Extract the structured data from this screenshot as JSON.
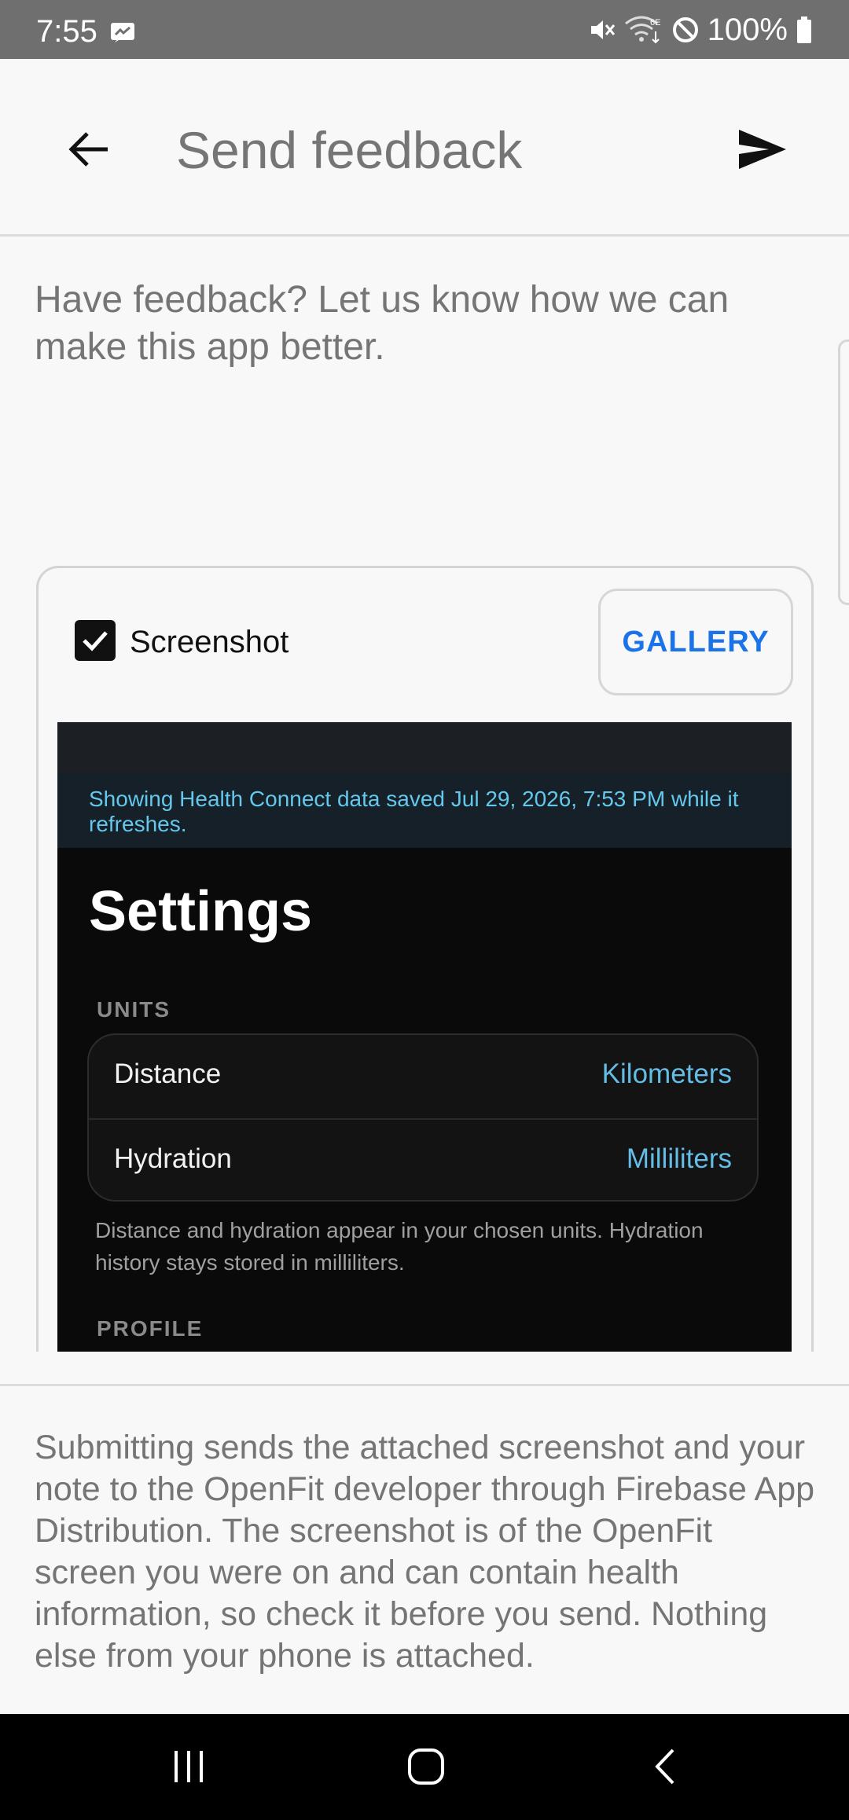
{
  "status_bar": {
    "time": "7:55",
    "battery": "100%",
    "icons": [
      "message-icon",
      "mute-icon",
      "wifi-6e-icon",
      "do-not-disturb-icon",
      "battery-icon"
    ]
  },
  "app_bar": {
    "title": "Send feedback",
    "back_icon": "arrow-left-icon",
    "send_icon": "send-icon"
  },
  "feedback_input": {
    "placeholder": "Have feedback? Let us know how we can make this app better.",
    "value": ""
  },
  "screenshot_card": {
    "checkbox_label": "Screenshot",
    "checked": true,
    "gallery_label": "GALLERY",
    "preview": {
      "banner": "Showing Health Connect data saved Jul 29, 2026, 7:53 PM while it refreshes.",
      "title": "Settings",
      "units_label": "UNITS",
      "units": [
        {
          "name": "Distance",
          "value": "Kilometers"
        },
        {
          "name": "Hydration",
          "value": "Milliliters"
        }
      ],
      "units_note": "Distance and hydration appear in your chosen units. Hydration history stays stored in milliliters.",
      "profile_label": "PROFILE"
    }
  },
  "disclaimer": "Submitting sends the attached screenshot and your note to the OpenFit developer through Firebase App Distribution. The screenshot is of the OpenFit screen you were on and can contain health information, so check it before you send. Nothing else from your phone is attached.",
  "nav_bar": {
    "icons": [
      "recents-icon",
      "home-icon",
      "back-icon"
    ]
  },
  "colors": {
    "accent": "#1a73e8",
    "preview_accent": "#64bde6",
    "status_bar": "#6f6f6f",
    "background": "#f8f8f8"
  }
}
